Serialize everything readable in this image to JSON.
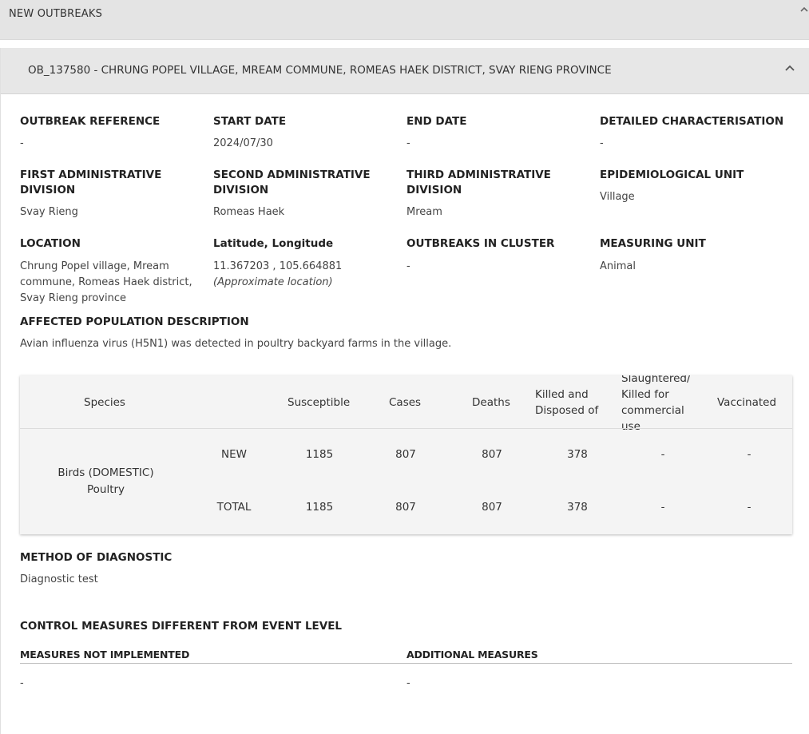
{
  "header": {
    "title": "NEW OUTBREAKS"
  },
  "outbreak": {
    "title": "OB_137580 - CHRUNG POPEL VILLAGE, MREAM COMMUNE, ROMEAS HAEK DISTRICT, SVAY RIENG PROVINCE",
    "fields": {
      "reference": {
        "label": "OUTBREAK REFERENCE",
        "value": "-"
      },
      "start_date": {
        "label": "START DATE",
        "value": "2024/07/30"
      },
      "end_date": {
        "label": "END DATE",
        "value": "-"
      },
      "characterisation": {
        "label": "DETAILED CHARACTERISATION",
        "value": "-"
      },
      "first_admin": {
        "label_1": "FIRST ADMINISTRATIVE",
        "label_2": "DIVISION",
        "value": "Svay Rieng"
      },
      "second_admin": {
        "label_1": "SECOND ADMINISTRATIVE",
        "label_2": "DIVISION",
        "value": "Romeas Haek"
      },
      "third_admin": {
        "label_1": "THIRD ADMINISTRATIVE",
        "label_2": "DIVISION",
        "value": "Mream"
      },
      "epi_unit": {
        "label": "EPIDEMIOLOGICAL UNIT",
        "value": "Village"
      },
      "location": {
        "label": "LOCATION",
        "value_1": "Chrung Popel village, Mream",
        "value_2": "commune, Romeas Haek district,",
        "value_3": "Svay Rieng province"
      },
      "latlong": {
        "label": "Latitude, Longitude",
        "value": "11.367203 , 105.664881",
        "note": "(Approximate location)"
      },
      "cluster": {
        "label": "OUTBREAKS IN CLUSTER",
        "value": "-"
      },
      "measuring_unit": {
        "label": "MEASURING UNIT",
        "value": "Animal"
      }
    },
    "population": {
      "label": "AFFECTED POPULATION DESCRIPTION",
      "value": "Avian influenza virus (H5N1) was detected in poultry backyard farms in the village."
    },
    "table": {
      "headers": {
        "species": "Species",
        "susceptible": "Susceptible",
        "cases": "Cases",
        "deaths": "Deaths",
        "killed_1": "Killed and",
        "killed_2": "Disposed of",
        "slaughtered_1": "Slaughtered/",
        "slaughtered_2": "Killed for",
        "slaughtered_3": "commercial",
        "slaughtered_4": "use",
        "vaccinated": "Vaccinated"
      },
      "species_1": "Birds (DOMESTIC)",
      "species_2": "Poultry",
      "rows": [
        {
          "type": "NEW",
          "susceptible": "1185",
          "cases": "807",
          "deaths": "807",
          "killed": "378",
          "slaughtered": "-",
          "vaccinated": "-"
        },
        {
          "type": "TOTAL",
          "susceptible": "1185",
          "cases": "807",
          "deaths": "807",
          "killed": "378",
          "slaughtered": "-",
          "vaccinated": "-"
        }
      ]
    },
    "diagnostic": {
      "label": "METHOD OF DIAGNOSTIC",
      "value": "Diagnostic test"
    },
    "control": {
      "title": "CONTROL MEASURES DIFFERENT FROM EVENT LEVEL",
      "not_implemented": {
        "label": "MEASURES NOT IMPLEMENTED",
        "value": "-"
      },
      "additional": {
        "label": "ADDITIONAL MEASURES",
        "value": "-"
      }
    }
  }
}
